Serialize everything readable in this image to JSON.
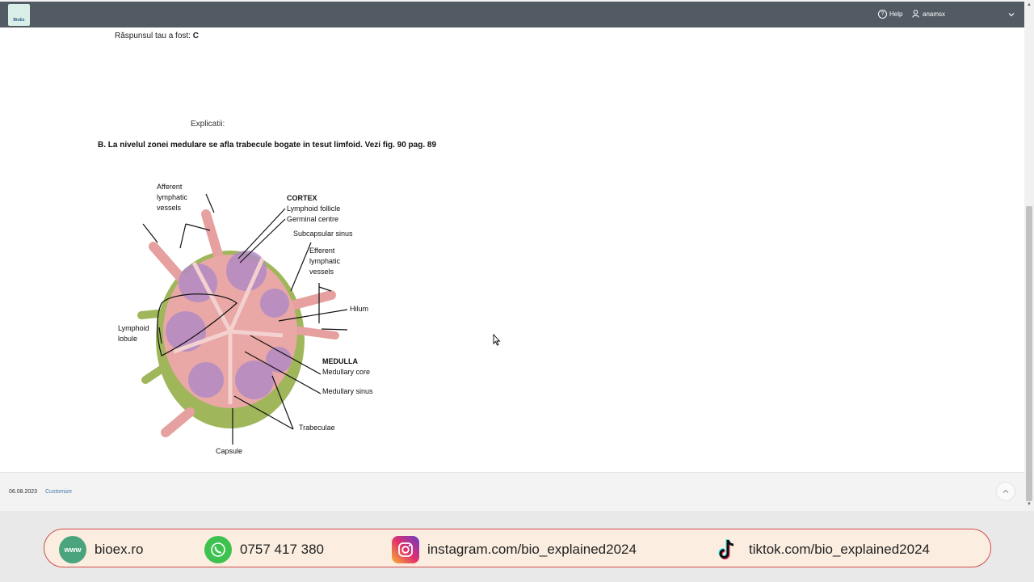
{
  "header": {
    "logo_text": "BioEx",
    "help_label": "Help",
    "user_label": "anamsx"
  },
  "content": {
    "answer_prefix": "Răspunsul tau a fost:",
    "answer_value": "C",
    "explanation_label": "Explicatii:",
    "explanation_text": "B. La nivelul zonei medulare se afla trabecule bogate in tesut limfoid. Vezi fig. 90 pag. 89"
  },
  "figure": {
    "labels": {
      "afferent": "Afferent\nlymphatic\nvessels",
      "cortex": "CORTEX",
      "lymphoid_follicle": "Lymphoid follicle",
      "germinal_centre": "Germinal centre",
      "subcapsular_sinus": "Subcapsular sinus",
      "efferent": "Efferent\nlymphatic\nvessels",
      "hilum": "Hilum",
      "lymphoid_lobule": "Lymphoid\nlobule",
      "medulla": "MEDULLA",
      "medullary_core": "Medullary core",
      "medullary_sinus": "Medullary sinus",
      "trabeculae": "Trabeculae",
      "capsule": "Capsule"
    }
  },
  "footer": {
    "date": "06.08.2023",
    "customize_label": "Customize"
  },
  "banner": {
    "website_icon": "www",
    "website": "bioex.ro",
    "phone": "0757 417 380",
    "instagram": "instagram.com/bio_explained2024",
    "tiktok": "tiktok.com/bio_explained2024",
    "border_color": "#d24b4b",
    "background": "#fbeee0"
  }
}
